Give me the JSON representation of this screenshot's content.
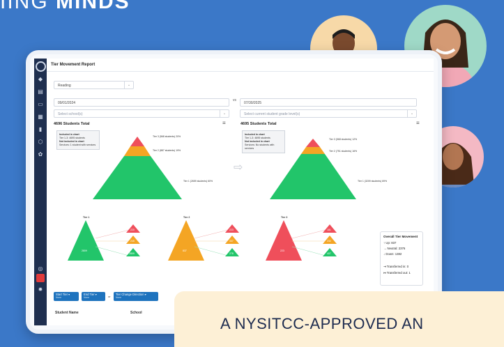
{
  "brand": {
    "partial_light": "IING ",
    "partial_bold": "MINDS"
  },
  "app": {
    "title": "Tier Movement Report",
    "subject_select": {
      "value": "Reading"
    },
    "start_date": "09/01/2024",
    "vs_label": "vs",
    "end_date": "07/30/2025",
    "school_select": {
      "placeholder": "Select school(s)"
    },
    "grade_select": {
      "placeholder": "Select current student grade level(s)"
    }
  },
  "left_pyramid": {
    "total": "4696 Students Total",
    "legend": {
      "included_heading": "Included in chart",
      "included_detail": "Tier 1-3: 4695 students",
      "not_included_heading": "Not included in chart",
      "not_included_detail": "Services: 1 student with services"
    },
    "tiers": [
      {
        "label": "Tier 3 (568 students) 20%",
        "color": "#ef4f5b"
      },
      {
        "label": "Tier 2 (887 students) 19%",
        "color": "#f4a524"
      },
      {
        "label": "Tier 1 (2659 students) 60%",
        "color": "#22c56a"
      }
    ]
  },
  "right_pyramid": {
    "total": "4695 Students Total",
    "legend": {
      "included_heading": "Included in chart",
      "included_detail": "Tier 1-3: 4695 students",
      "not_included_heading": "Not included in chart",
      "not_included_detail": "Services: No students with services"
    },
    "tiers": [
      {
        "label": "Tier 3 (568 students) 12%",
        "color": "#ef4f5b"
      },
      {
        "label": "Tier 2 (751 students) 16%",
        "color": "#f4a524"
      },
      {
        "label": "Tier 1 (3209 students) 69%",
        "color": "#22c56a"
      }
    ]
  },
  "movement": [
    {
      "title": "Tier 1",
      "center": "2809",
      "color": "#22c56a",
      "outs": [
        "220",
        "245",
        "2809"
      ]
    },
    {
      "title": "Tier 2",
      "center": "837",
      "color": "#f4a524",
      "outs": [
        "223",
        "337",
        "278"
      ]
    },
    {
      "title": "Tier 3",
      "center": "223",
      "color": "#ef4f5b",
      "outs": [
        "181",
        "232",
        "407"
      ]
    }
  ],
  "summary": {
    "heading": "Overall Tier Movement",
    "up": "Up: 837",
    "neutral": "Neutral: 2376",
    "down": "Down: 1382",
    "transferred_in": "Transferred in: 0",
    "transferred_out": "Transferred out: 1"
  },
  "filters": {
    "start_tier": {
      "label": "Start Tier",
      "sub": "None"
    },
    "end_tier": {
      "label": "End Tier",
      "sub": "None"
    },
    "or_label": "or",
    "change_direction": {
      "label": "Tier Change Direction",
      "sub": "None"
    }
  },
  "table": {
    "columns": [
      "Student Name",
      "School"
    ]
  },
  "banner": {
    "text": "A NYSITCC-APPROVED AN"
  },
  "colors": {
    "background": "#3b78c8",
    "rail": "#1f2f4f",
    "accent": "#1e73be",
    "green": "#22c56a",
    "orange": "#f4a524",
    "red": "#ef4f5b",
    "banner": "#fdf0d6"
  }
}
